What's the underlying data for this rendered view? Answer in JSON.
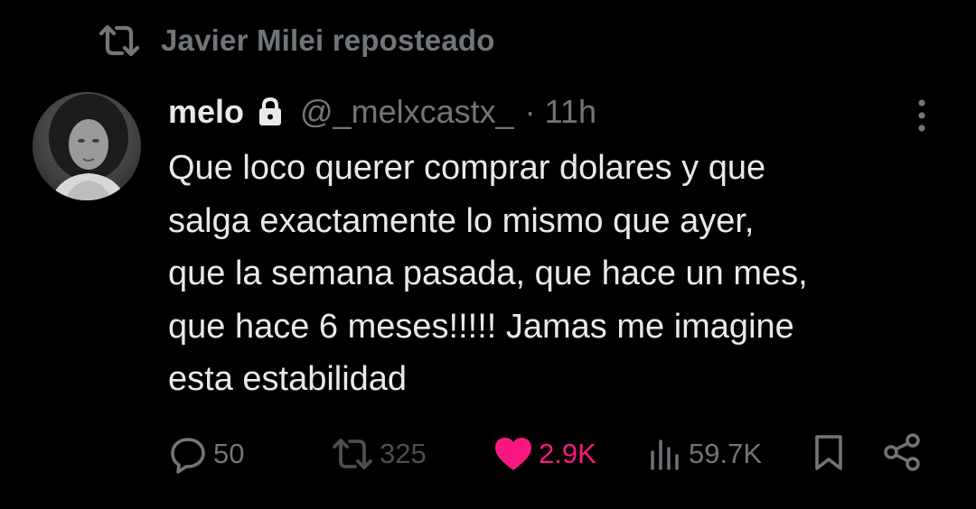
{
  "repost": {
    "text": "Javier Milei reposteado",
    "icon": "repost-icon"
  },
  "author": {
    "display_name": "melo",
    "protected_icon": "lock-icon",
    "handle": "@_melxcastx_",
    "separator": "·",
    "time": "11h"
  },
  "tweet": {
    "lines": [
      "Que loco querer comprar dolares y que",
      "salga exactamente lo mismo que ayer,",
      "que la semana pasada, que hace un mes,",
      "que hace 6 meses!!!!! Jamas me imagine",
      "esta estabilidad"
    ]
  },
  "actions": {
    "replies": "50",
    "reposts": "325",
    "likes": "2.9K",
    "views": "59.7K"
  },
  "colors": {
    "background": "#000000",
    "text": "#e7e9ea",
    "muted": "#71767b",
    "like": "#f91880"
  }
}
